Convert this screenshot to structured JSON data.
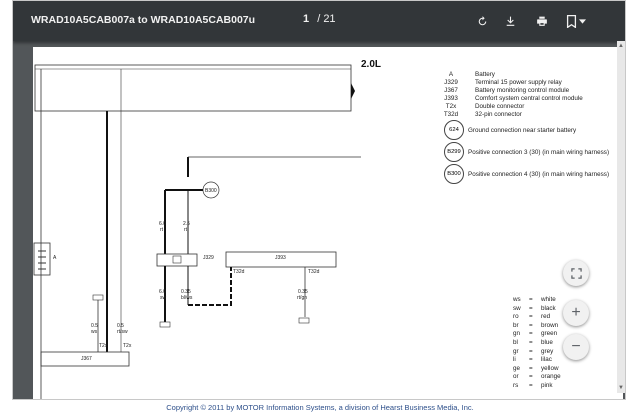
{
  "toolbar": {
    "title": "WRAD10A5CAB007a to WRAD10A5CAB007u",
    "page_current": "1",
    "page_separator": "/",
    "page_total": "21",
    "icons": [
      "rotate-icon",
      "download-icon",
      "print-icon",
      "bookmark-icon",
      "chevron-down-icon"
    ]
  },
  "diagram": {
    "engine_label": "2.0L",
    "legend": [
      {
        "code": "A",
        "desc": "Battery"
      },
      {
        "code": "J329",
        "desc": "Terminal 15 power supply relay"
      },
      {
        "code": "J367",
        "desc": "Battery monitoring control module"
      },
      {
        "code": "J393",
        "desc": "Comfort system central control module"
      },
      {
        "code": "T2x",
        "desc": "Double connector"
      },
      {
        "code": "T32d",
        "desc": "32-pin connector"
      }
    ],
    "grounds": [
      {
        "code": "624",
        "desc": "Ground connection near starter battery"
      },
      {
        "code": "B299",
        "desc": "Positive connection 3 (30) (in main wiring harness)"
      },
      {
        "code": "B300",
        "desc": "Positive connection 4 (30) (in main wiring harness)"
      }
    ],
    "colors": [
      [
        "ws",
        "=",
        "white"
      ],
      [
        "sw",
        "=",
        "black"
      ],
      [
        "ro",
        "=",
        "red"
      ],
      [
        "br",
        "=",
        "brown"
      ],
      [
        "gn",
        "=",
        "green"
      ],
      [
        "bl",
        "=",
        "blue"
      ],
      [
        "gr",
        "=",
        "grey"
      ],
      [
        "li",
        "=",
        "lilac"
      ],
      [
        "ge",
        "=",
        "yellow"
      ],
      [
        "or",
        "=",
        "orange"
      ],
      [
        "rs",
        "=",
        "pink"
      ]
    ],
    "labels": {
      "a": "A",
      "j329": "J329",
      "j393": "J393",
      "j367": "J367",
      "b300": "B300",
      "w1": "6.0",
      "w1c": "rt",
      "w2": "2.5",
      "w2c": "rt",
      "w3": "6.0",
      "w3c": "sw",
      "w4": "0.35",
      "w4c": "bl/ws",
      "w5": "0.35",
      "w5c": "rt/gn",
      "w6": "0.5",
      "w6c": "ws",
      "w7": "0.5",
      "w7c": "rt/sw",
      "w8": "0.5",
      "w8c": "rt/sw",
      "t2x1": "T2x",
      "t2x2": "T2x",
      "t32d1": "T32d",
      "t32d2": "T32d"
    }
  },
  "zoom_controls": {
    "fit": "fit-to-page-icon",
    "plus": "+",
    "minus": "−"
  },
  "footer": {
    "copyright": "Copyright © 2011 by MOTOR Information Systems, a division of Hearst Business Media, Inc."
  }
}
